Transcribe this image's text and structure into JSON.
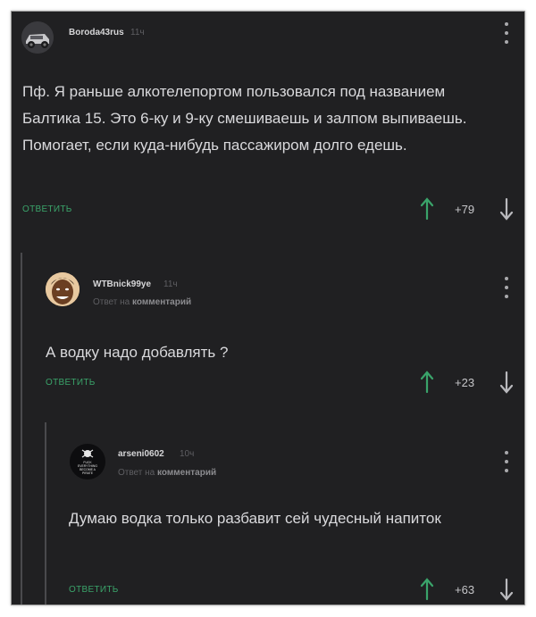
{
  "comments": [
    {
      "username": "Boroda43rus",
      "time": "11ч",
      "reply_prefix": "",
      "reply_target": "",
      "text": "Пф. Я раньше алкотелепортом пользовался под названием Балтика 15. Это 6-ку и 9-ку смешиваешь и залпом выпиваешь. Помогает, если куда-нибудь пассажиром долго едешь.",
      "reply_label": "ОТВЕТИТЬ",
      "rating": "+79"
    },
    {
      "username": "WTBnick99ye",
      "time": "11ч",
      "reply_prefix": "Ответ на",
      "reply_target": "комментарий",
      "text": "А водку надо добавлять ?",
      "reply_label": "ОТВЕТИТЬ",
      "rating": "+23"
    },
    {
      "username": "arseni0602",
      "time": "10ч",
      "reply_prefix": "Ответ на",
      "reply_target": "комментарий",
      "text": "Думаю водка только разбавит сей чудесный напиток",
      "reply_label": "ОТВЕТИТЬ",
      "rating": "+63",
      "avatar_text": "FUCK EVERYTHING BECOME A PIRATE"
    }
  ],
  "colors": {
    "background": "#202022",
    "accent_green": "#3aa36a",
    "text": "#d9d9dc",
    "muted": "#5e5e62"
  },
  "icons": [
    "car-avatar",
    "menu-dots-icon",
    "arrow-up-icon",
    "arrow-down-icon",
    "skull-avatar"
  ]
}
